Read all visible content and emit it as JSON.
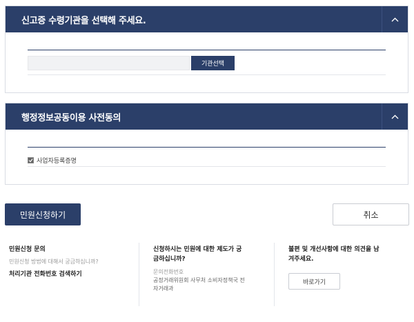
{
  "section1": {
    "title": "신고증 수령기관을 선택해 주세요.",
    "org_input_value": "",
    "select_button": "기관선택"
  },
  "section2": {
    "title": "행정정보공동이용 사전동의",
    "consent_label": "사업자등록증명",
    "consent_checked": true
  },
  "actions": {
    "submit": "민원신청하기",
    "cancel": "취소"
  },
  "help": {
    "col1": {
      "title": "민원신청 문의",
      "sub": "민원신청 방법에 대해서 궁금하십니까?",
      "link": "처리기관 전화번호 검색하기"
    },
    "col2": {
      "title_line1": "신청하시는 민원에 대한 제도가 궁",
      "title_line2": "금하십니까?",
      "label": "문의전화번호",
      "text_line1": "공정거래위원회 사무처 소비자정책국 전",
      "text_line2": "자거래과"
    },
    "col3": {
      "title_line1": "불편 및 개선사항에 대한 의견을 남",
      "title_line2": "겨주세요.",
      "button": "바로가기"
    }
  },
  "colors": {
    "primary": "#2b3f69",
    "border": "#d9dce3"
  },
  "icons": {
    "toggle": "chevron-up-icon",
    "check": "check-icon"
  }
}
